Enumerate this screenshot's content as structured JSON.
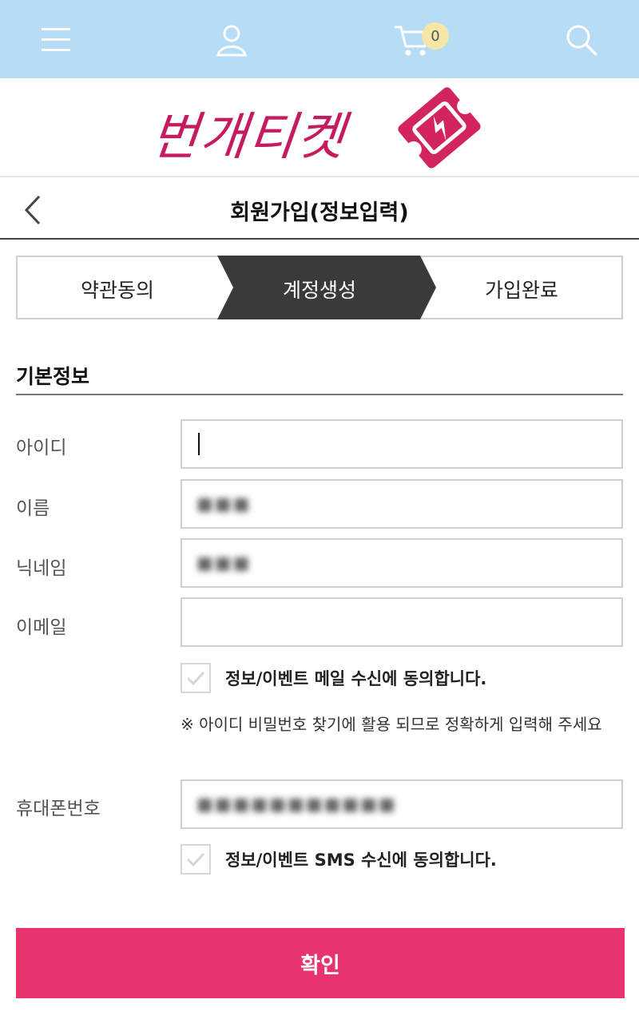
{
  "nav": {
    "icons": [
      "menu-icon",
      "user-icon",
      "cart-icon",
      "search-icon"
    ],
    "cart_count": "0",
    "background": "#b6dcf6"
  },
  "logo": {
    "text": "번개티켓",
    "color": "#c61b61"
  },
  "header": {
    "title": "회원가입(정보입력)"
  },
  "steps": [
    {
      "label": "약관동의",
      "active": false
    },
    {
      "label": "계정생성",
      "active": true
    },
    {
      "label": "가입완료",
      "active": false
    }
  ],
  "section": {
    "title": "기본정보"
  },
  "form": {
    "id_label": "아이디",
    "id_value": "",
    "name_label": "이름",
    "name_value": "■■■",
    "nickname_label": "닉네임",
    "nickname_value": "■■■",
    "email_label": "이메일",
    "email_value": "",
    "email_consent": "정보/이벤트 메일 수신에 동의합니다.",
    "notice": "※ 아이디 비밀번호 찾기에 활용 되므로 정확하게 입력해 주세요",
    "phone_label": "휴대폰번호",
    "phone_value": "■■■■■■■■■■■",
    "sms_consent": "정보/이벤트 SMS 수신에 동의합니다."
  },
  "actions": {
    "confirm_label": "확인",
    "confirm_color": "#e8336c"
  }
}
